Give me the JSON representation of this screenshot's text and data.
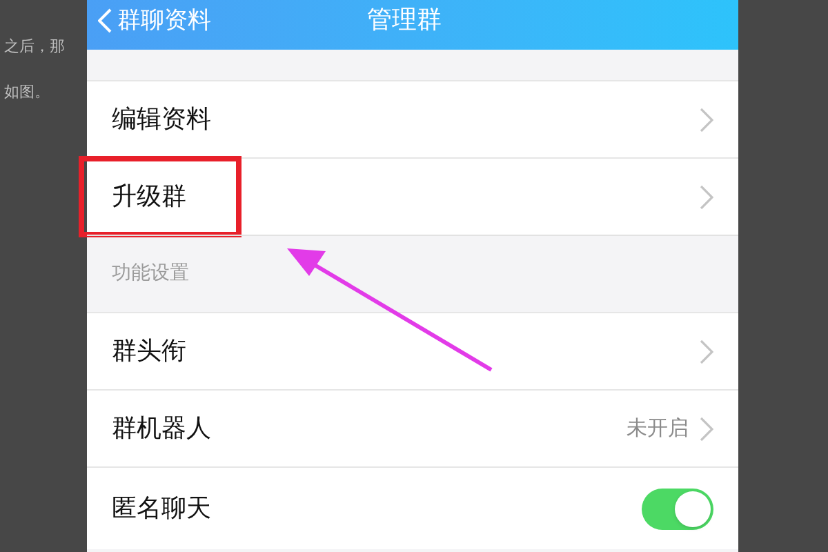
{
  "background_text": [
    "之后，那",
    "如图。"
  ],
  "header": {
    "back_label": "群聊资料",
    "title": "管理群"
  },
  "rows": [
    {
      "kind": "link",
      "label": "编辑资料",
      "highlighted": false
    },
    {
      "kind": "link",
      "label": "升级群",
      "highlighted": true
    },
    {
      "kind": "section",
      "label": "功能设置"
    },
    {
      "kind": "link",
      "label": "群头衔",
      "highlighted": false
    },
    {
      "kind": "link",
      "label": "群机器人",
      "value": "未开启",
      "highlighted": false
    },
    {
      "kind": "toggle",
      "label": "匿名聊天",
      "on": true
    }
  ]
}
